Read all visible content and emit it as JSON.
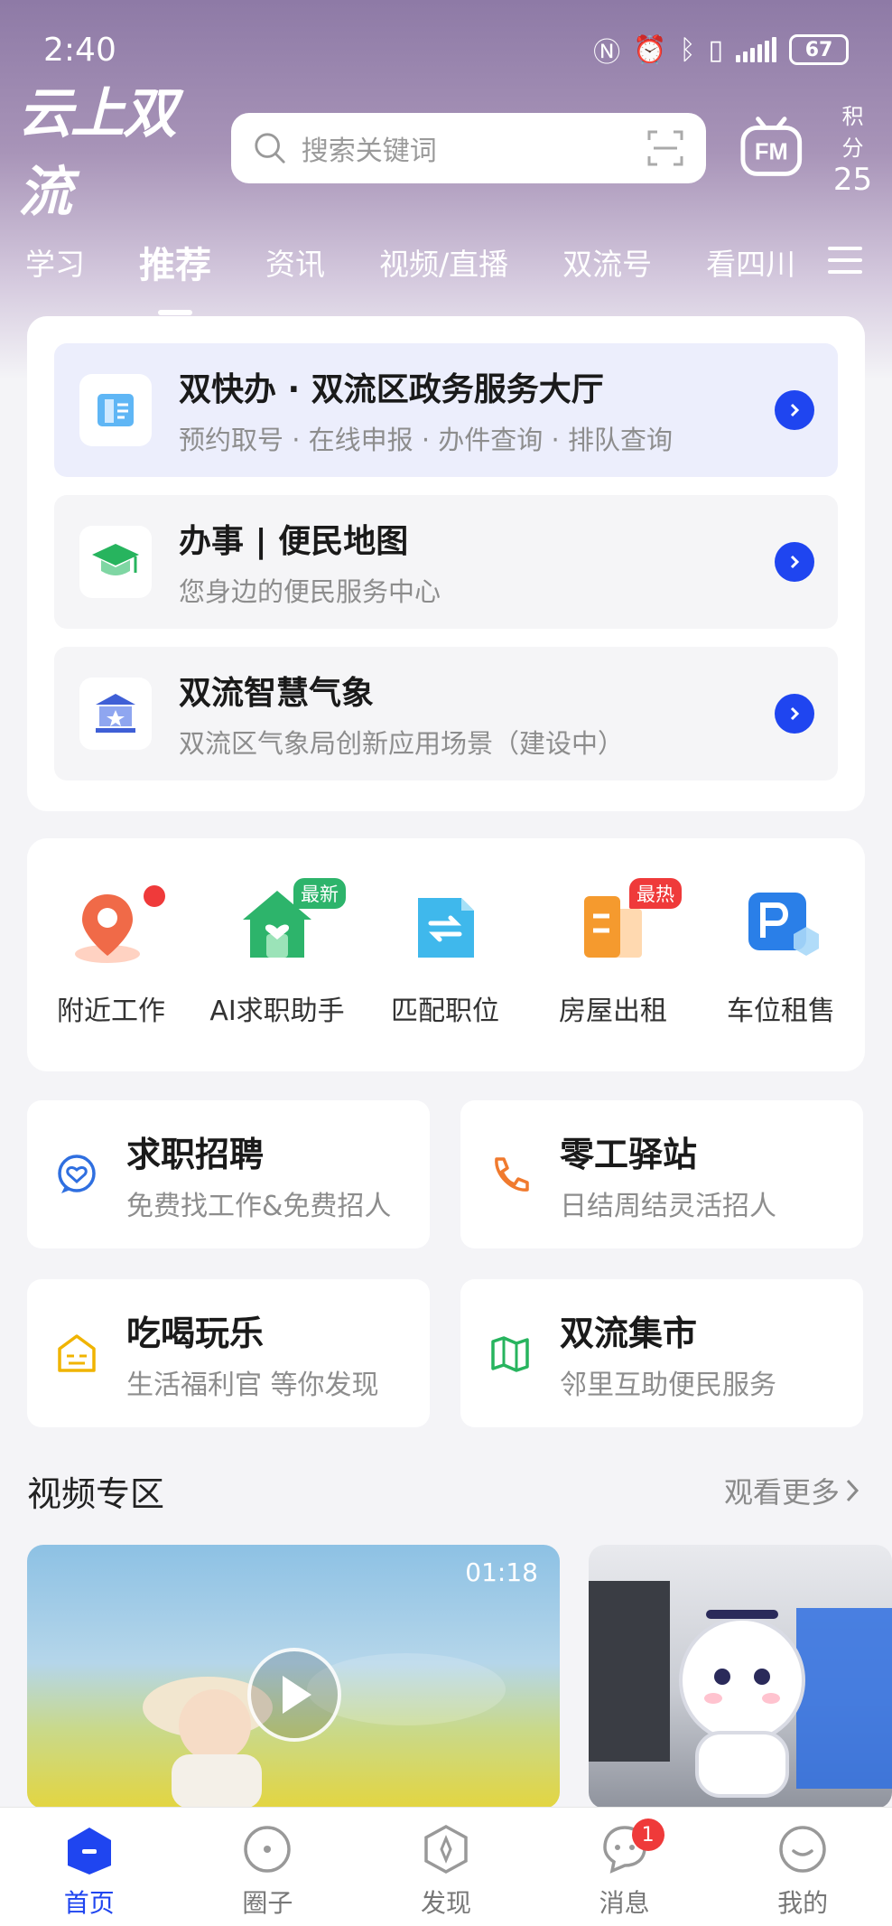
{
  "status_bar": {
    "time": "2:40",
    "battery": "67"
  },
  "header": {
    "app_name": "云上双流",
    "search_placeholder": "搜索关键词",
    "points_label": "积分",
    "points_value": "25",
    "fm_label": "FM"
  },
  "tabs": [
    {
      "label": "学习"
    },
    {
      "label": "推荐",
      "active": true
    },
    {
      "label": "资讯"
    },
    {
      "label": "视频/直播"
    },
    {
      "label": "双流号"
    },
    {
      "label": "看四川"
    }
  ],
  "services": [
    {
      "title": "双快办 · 双流区政务服务大厅",
      "subtitle": "预约取号 · 在线申报 · 办件查询 · 排队查询",
      "icon": "document-icon"
    },
    {
      "title": "办事 | 便民地图",
      "subtitle": "您身边的便民服务中心",
      "icon": "graduation-cap-icon"
    },
    {
      "title": "双流智慧气象",
      "subtitle": "双流区气象局创新应用场景（建设中）",
      "icon": "government-building-icon"
    }
  ],
  "quick_actions": [
    {
      "label": "附近工作",
      "icon": "location-pin-icon"
    },
    {
      "label": "AI求职助手",
      "icon": "house-heart-icon",
      "tag": "最新"
    },
    {
      "label": "匹配职位",
      "icon": "swap-arrows-icon"
    },
    {
      "label": "房屋出租",
      "icon": "building-icon",
      "tag": "最热"
    },
    {
      "label": "车位租售",
      "icon": "parking-icon"
    }
  ],
  "tiles": [
    {
      "title": "求职招聘",
      "subtitle": "免费找工作&免费招人",
      "icon": "heart-chat-icon",
      "color": "#2f6fe0"
    },
    {
      "title": "零工驿站",
      "subtitle": "日结周结灵活招人",
      "icon": "phone-icon",
      "color": "#f07a2e"
    },
    {
      "title": "吃喝玩乐",
      "subtitle": "生活福利官 等你发现",
      "icon": "shop-icon",
      "color": "#f0b400"
    },
    {
      "title": "双流集市",
      "subtitle": "邻里互助便民服务",
      "icon": "map-icon",
      "color": "#27b45e"
    }
  ],
  "video_section": {
    "title": "视频专区",
    "more": "观看更多",
    "videos": [
      {
        "duration": "01:18"
      }
    ]
  },
  "bottom_nav": [
    {
      "label": "首页",
      "icon": "home-icon",
      "active": true
    },
    {
      "label": "圈子",
      "icon": "circle-icon"
    },
    {
      "label": "发现",
      "icon": "compass-icon"
    },
    {
      "label": "消息",
      "icon": "message-icon",
      "badge": "1"
    },
    {
      "label": "我的",
      "icon": "profile-icon"
    }
  ],
  "colors": {
    "accent": "#1f45f0",
    "hot": "#ef3a3a",
    "new": "#2db46b"
  }
}
